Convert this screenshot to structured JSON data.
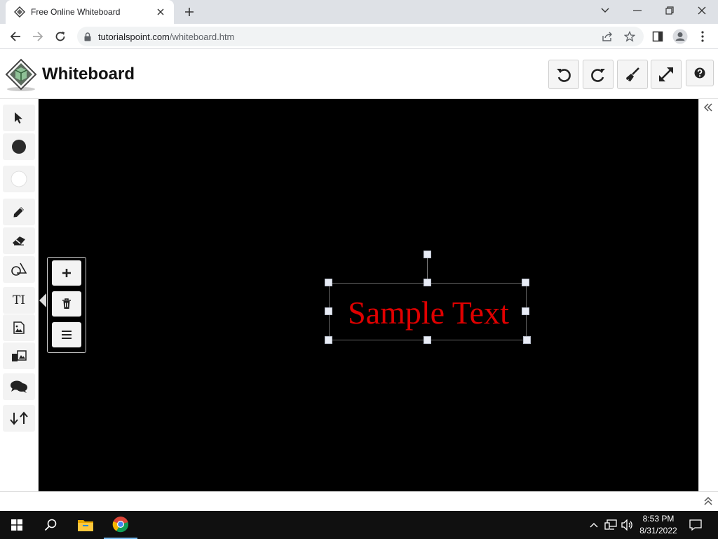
{
  "browser": {
    "tab_title": "Free Online Whiteboard",
    "url_host": "tutorialspoint.com",
    "url_path": "/whiteboard.htm"
  },
  "app": {
    "title": "Whiteboard"
  },
  "header_buttons": [
    "undo-icon",
    "redo-icon",
    "brush-icon",
    "expand-icon",
    "help-icon"
  ],
  "tools": [
    "pointer-icon",
    "color-fill-icon",
    "color-stroke-icon",
    "pencil-icon",
    "eraser-icon",
    "shapes-icon",
    "text-icon",
    "image-icon",
    "image-text-icon",
    "comments-icon",
    "arrange-icon"
  ],
  "text_tool_label": "TI",
  "popout_buttons": [
    "add-icon",
    "trash-icon",
    "menu-icon"
  ],
  "canvas": {
    "background": "#000000",
    "text_object": {
      "text": "Sample Text",
      "color": "#e00000"
    }
  },
  "taskbar": {
    "time": "8:53 PM",
    "date": "8/31/2022"
  }
}
